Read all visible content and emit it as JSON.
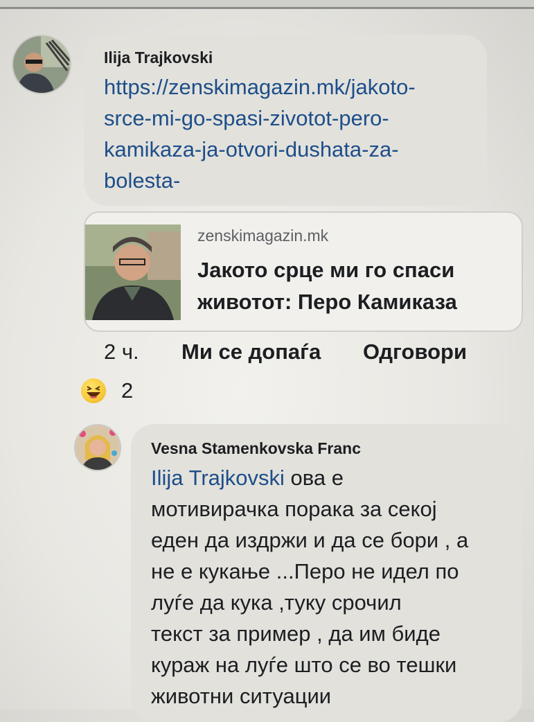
{
  "comment1": {
    "author": "Ilija Trajkovski",
    "link_lines": [
      "https://zenskimagazin.mk/jakoto-",
      "srce-mi-go-spasi-zivotot-pero-",
      "kamikaza-ja-otvori-dushata-za-",
      "bolesta-"
    ],
    "preview": {
      "domain": "zenskimagazin.mk",
      "title_lines": [
        "Јакото срце ми го спаси",
        "животот: Перо Камиказа"
      ]
    },
    "time": "2 ч.",
    "like_label": "Ми се допаѓа",
    "reply_label": "Одговори",
    "reaction": {
      "icon": "laughing-emoji-icon",
      "count": "2"
    }
  },
  "comment2": {
    "author": "Vesna Stamenkovska Franc",
    "mention": "Ilija Trajkovski",
    "text_lines": [
      " ова е",
      "мотивирачка порака за секој",
      "еден да издржи и да се бори , а",
      "не е кукање ...Перо не идел по",
      "луѓе да кука ,туку срочил",
      "текст за пример , да им биде",
      "кураж на луѓе што се во тешки",
      "животни ситуации"
    ]
  },
  "colors": {
    "bubble": "#e2e1dc",
    "link": "#1d4e89",
    "text": "#1c1e21"
  }
}
